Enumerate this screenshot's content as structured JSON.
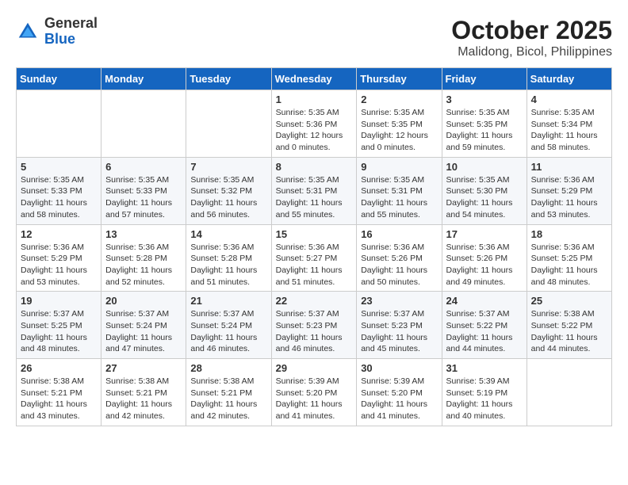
{
  "header": {
    "logo_general": "General",
    "logo_blue": "Blue",
    "month_title": "October 2025",
    "location": "Malidong, Bicol, Philippines"
  },
  "days_of_week": [
    "Sunday",
    "Monday",
    "Tuesday",
    "Wednesday",
    "Thursday",
    "Friday",
    "Saturday"
  ],
  "weeks": [
    [
      {
        "day": "",
        "info": ""
      },
      {
        "day": "",
        "info": ""
      },
      {
        "day": "",
        "info": ""
      },
      {
        "day": "1",
        "info": "Sunrise: 5:35 AM\nSunset: 5:36 PM\nDaylight: 12 hours\nand 0 minutes."
      },
      {
        "day": "2",
        "info": "Sunrise: 5:35 AM\nSunset: 5:35 PM\nDaylight: 12 hours\nand 0 minutes."
      },
      {
        "day": "3",
        "info": "Sunrise: 5:35 AM\nSunset: 5:35 PM\nDaylight: 11 hours\nand 59 minutes."
      },
      {
        "day": "4",
        "info": "Sunrise: 5:35 AM\nSunset: 5:34 PM\nDaylight: 11 hours\nand 58 minutes."
      }
    ],
    [
      {
        "day": "5",
        "info": "Sunrise: 5:35 AM\nSunset: 5:33 PM\nDaylight: 11 hours\nand 58 minutes."
      },
      {
        "day": "6",
        "info": "Sunrise: 5:35 AM\nSunset: 5:33 PM\nDaylight: 11 hours\nand 57 minutes."
      },
      {
        "day": "7",
        "info": "Sunrise: 5:35 AM\nSunset: 5:32 PM\nDaylight: 11 hours\nand 56 minutes."
      },
      {
        "day": "8",
        "info": "Sunrise: 5:35 AM\nSunset: 5:31 PM\nDaylight: 11 hours\nand 55 minutes."
      },
      {
        "day": "9",
        "info": "Sunrise: 5:35 AM\nSunset: 5:31 PM\nDaylight: 11 hours\nand 55 minutes."
      },
      {
        "day": "10",
        "info": "Sunrise: 5:35 AM\nSunset: 5:30 PM\nDaylight: 11 hours\nand 54 minutes."
      },
      {
        "day": "11",
        "info": "Sunrise: 5:36 AM\nSunset: 5:29 PM\nDaylight: 11 hours\nand 53 minutes."
      }
    ],
    [
      {
        "day": "12",
        "info": "Sunrise: 5:36 AM\nSunset: 5:29 PM\nDaylight: 11 hours\nand 53 minutes."
      },
      {
        "day": "13",
        "info": "Sunrise: 5:36 AM\nSunset: 5:28 PM\nDaylight: 11 hours\nand 52 minutes."
      },
      {
        "day": "14",
        "info": "Sunrise: 5:36 AM\nSunset: 5:28 PM\nDaylight: 11 hours\nand 51 minutes."
      },
      {
        "day": "15",
        "info": "Sunrise: 5:36 AM\nSunset: 5:27 PM\nDaylight: 11 hours\nand 51 minutes."
      },
      {
        "day": "16",
        "info": "Sunrise: 5:36 AM\nSunset: 5:26 PM\nDaylight: 11 hours\nand 50 minutes."
      },
      {
        "day": "17",
        "info": "Sunrise: 5:36 AM\nSunset: 5:26 PM\nDaylight: 11 hours\nand 49 minutes."
      },
      {
        "day": "18",
        "info": "Sunrise: 5:36 AM\nSunset: 5:25 PM\nDaylight: 11 hours\nand 48 minutes."
      }
    ],
    [
      {
        "day": "19",
        "info": "Sunrise: 5:37 AM\nSunset: 5:25 PM\nDaylight: 11 hours\nand 48 minutes."
      },
      {
        "day": "20",
        "info": "Sunrise: 5:37 AM\nSunset: 5:24 PM\nDaylight: 11 hours\nand 47 minutes."
      },
      {
        "day": "21",
        "info": "Sunrise: 5:37 AM\nSunset: 5:24 PM\nDaylight: 11 hours\nand 46 minutes."
      },
      {
        "day": "22",
        "info": "Sunrise: 5:37 AM\nSunset: 5:23 PM\nDaylight: 11 hours\nand 46 minutes."
      },
      {
        "day": "23",
        "info": "Sunrise: 5:37 AM\nSunset: 5:23 PM\nDaylight: 11 hours\nand 45 minutes."
      },
      {
        "day": "24",
        "info": "Sunrise: 5:37 AM\nSunset: 5:22 PM\nDaylight: 11 hours\nand 44 minutes."
      },
      {
        "day": "25",
        "info": "Sunrise: 5:38 AM\nSunset: 5:22 PM\nDaylight: 11 hours\nand 44 minutes."
      }
    ],
    [
      {
        "day": "26",
        "info": "Sunrise: 5:38 AM\nSunset: 5:21 PM\nDaylight: 11 hours\nand 43 minutes."
      },
      {
        "day": "27",
        "info": "Sunrise: 5:38 AM\nSunset: 5:21 PM\nDaylight: 11 hours\nand 42 minutes."
      },
      {
        "day": "28",
        "info": "Sunrise: 5:38 AM\nSunset: 5:21 PM\nDaylight: 11 hours\nand 42 minutes."
      },
      {
        "day": "29",
        "info": "Sunrise: 5:39 AM\nSunset: 5:20 PM\nDaylight: 11 hours\nand 41 minutes."
      },
      {
        "day": "30",
        "info": "Sunrise: 5:39 AM\nSunset: 5:20 PM\nDaylight: 11 hours\nand 41 minutes."
      },
      {
        "day": "31",
        "info": "Sunrise: 5:39 AM\nSunset: 5:19 PM\nDaylight: 11 hours\nand 40 minutes."
      },
      {
        "day": "",
        "info": ""
      }
    ]
  ]
}
